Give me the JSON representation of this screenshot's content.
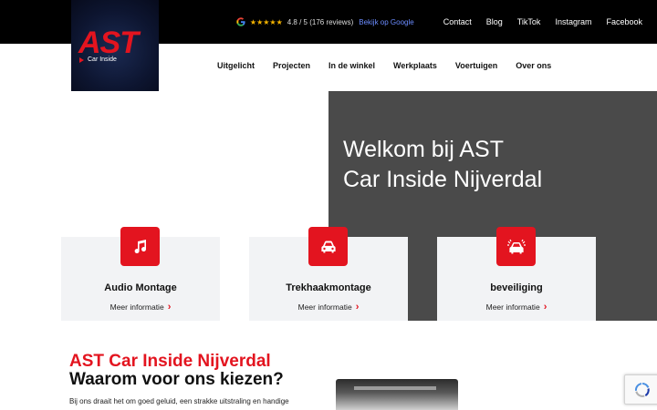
{
  "brand": {
    "logo_text": "AST",
    "logo_subtitle": "Car Inside"
  },
  "topbar": {
    "rating": "4.8 / 5 (176 reviews)",
    "google_link": "Bekijk op Google",
    "links": [
      "Contact",
      "Blog",
      "TikTok",
      "Instagram",
      "Facebook"
    ]
  },
  "mainnav": [
    "Uitgelicht",
    "Projecten",
    "In de winkel",
    "Werkplaats",
    "Voertuigen",
    "Over ons"
  ],
  "hero": {
    "line1": "Welkom bij AST",
    "line2": "Car Inside Nijverdal"
  },
  "cards": [
    {
      "title": "Audio Montage",
      "more": "Meer informatie",
      "icon": "music-note-icon"
    },
    {
      "title": "Trekhaakmontage",
      "more": "Meer informatie",
      "icon": "car-icon"
    },
    {
      "title": "beveiliging",
      "more": "Meer informatie",
      "icon": "car-alarm-icon"
    }
  ],
  "intro": {
    "title_red": "AST Car Inside Nijverdal",
    "title_dark": "Waarom voor ons kiezen?",
    "text": "Bij ons draait het om goed geluid, een strakke uitstraling en handige"
  },
  "colors": {
    "accent": "#e3141f",
    "topbar": "#000000",
    "hero": "#4a4a4a",
    "card": "#f2f3f5"
  }
}
